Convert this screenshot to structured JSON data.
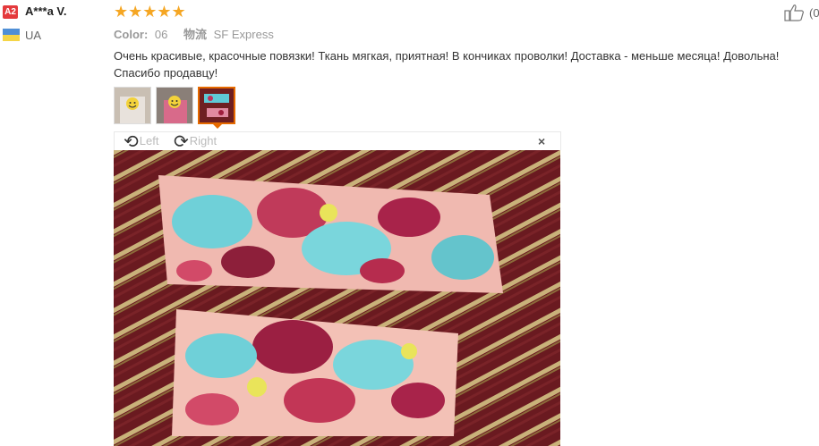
{
  "reviewer": {
    "badge": "A2",
    "name": "A***a V.",
    "country": "UA"
  },
  "rating": {
    "stars": "★★★★★",
    "value": 5
  },
  "meta": {
    "color_label": "Color:",
    "color_value": "06",
    "logistics_label": "物流",
    "logistics_value": "SF Express"
  },
  "review": {
    "text": "Очень красивые, красочные повязки! Ткань мягкая, приятная! В кончиках проволки! Доставка - меньше месяца! Довольна! Спасибо продавцу!"
  },
  "helpful": {
    "count": "(0"
  },
  "viewer": {
    "left_label": "Left",
    "right_label": "Right",
    "close_glyph": "×"
  },
  "colors": {
    "star": "#f5a623",
    "active_thumb": "#e66a00",
    "badge": "#e4393c"
  }
}
